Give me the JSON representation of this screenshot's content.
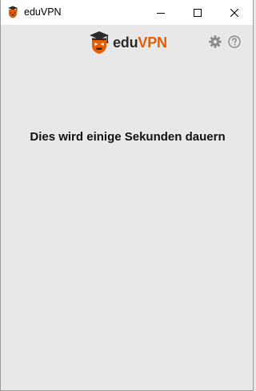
{
  "window": {
    "title": "eduVPN"
  },
  "header": {
    "logo_part1": "edu",
    "logo_part2": "VPN",
    "logo_color_dark": "#2b2b2b",
    "logo_color_accent": "#e65c00",
    "settings_icon": "gear-icon",
    "help_icon": "question-circle-icon"
  },
  "main": {
    "status_message": "Dies wird einige Sekunden dauern"
  }
}
